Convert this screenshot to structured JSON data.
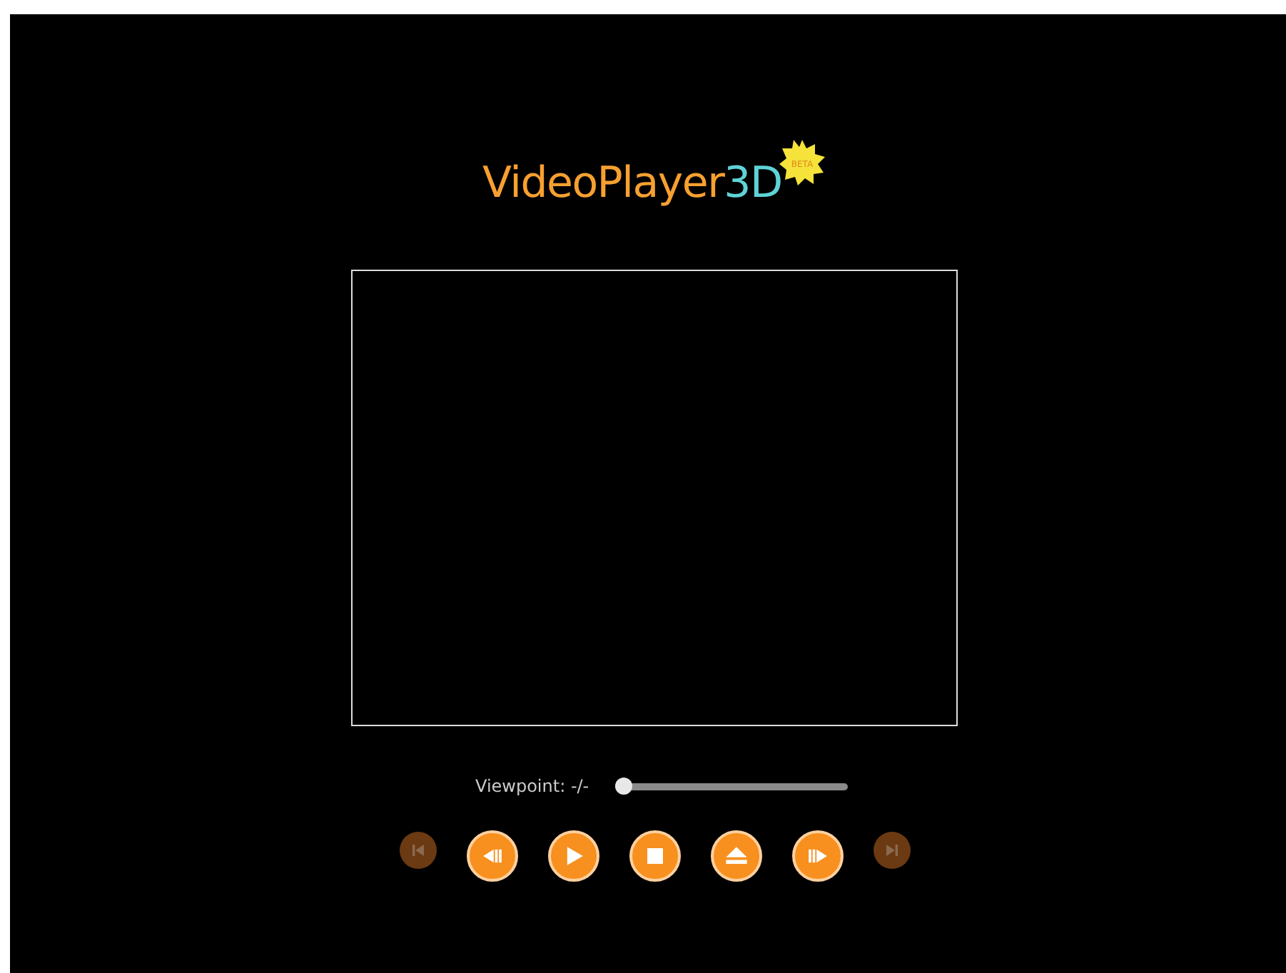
{
  "logo": {
    "name": "VideoPlayer",
    "suffix": "3D",
    "badge": "BETA"
  },
  "viewpoint": {
    "label": "Viewpoint: -/-",
    "level": 0
  },
  "controls": [
    {
      "kind": "first",
      "disabled": true
    },
    {
      "kind": "step-back",
      "disabled": false
    },
    {
      "kind": "play",
      "disabled": false
    },
    {
      "kind": "stop",
      "disabled": false
    },
    {
      "kind": "eject",
      "disabled": false
    },
    {
      "kind": "step-forward",
      "disabled": false
    },
    {
      "kind": "last",
      "disabled": true
    }
  ]
}
